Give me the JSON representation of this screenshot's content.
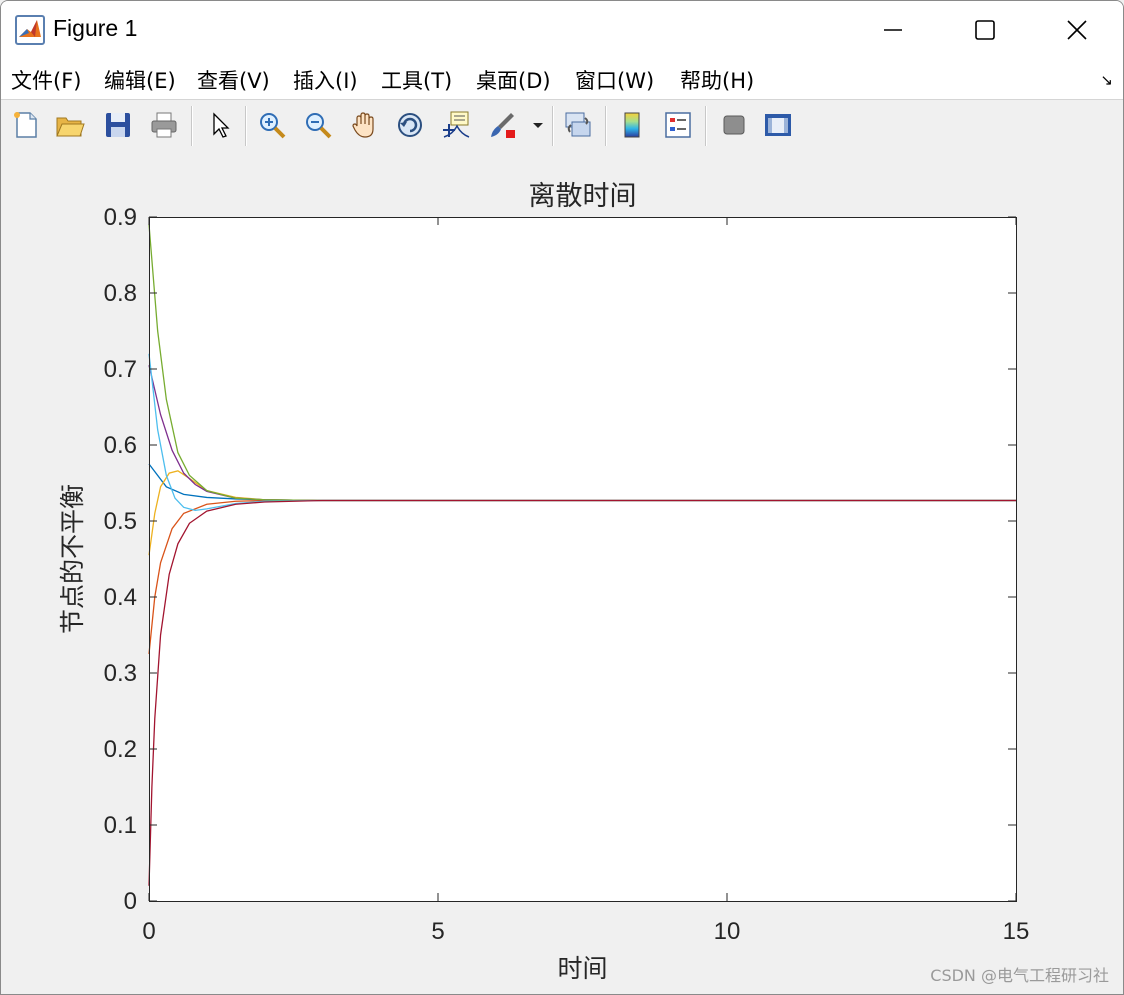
{
  "window": {
    "title": "Figure 1",
    "controls": {
      "minimize": "minimize-icon",
      "maximize": "maximize-icon",
      "close": "close-icon"
    }
  },
  "menubar": {
    "items": [
      "文件(F)",
      "编辑(E)",
      "查看(V)",
      "插入(I)",
      "工具(T)",
      "桌面(D)",
      "窗口(W)",
      "帮助(H)"
    ]
  },
  "toolbar": {
    "buttons": [
      "new-figure-icon",
      "open-file-icon",
      "save-icon",
      "print-icon",
      "pointer-arrow-icon",
      "zoom-in-icon",
      "zoom-out-icon",
      "pan-hand-icon",
      "rotate-3d-icon",
      "data-cursor-icon",
      "brush-icon",
      "brush-dropdown-icon",
      "link-plot-icon",
      "colorbar-icon",
      "legend-icon",
      "hide-plot-tools-icon",
      "show-plot-tools-icon"
    ]
  },
  "watermark": "CSDN @电气工程研习社",
  "chart_data": {
    "type": "line",
    "title": "离散时间",
    "xlabel": "时间",
    "ylabel": "节点的不平衡",
    "xlim": [
      0,
      15
    ],
    "ylim": [
      0,
      0.9
    ],
    "xticks": [
      "0",
      "5",
      "10",
      "15"
    ],
    "yticks": [
      "0",
      "0.1",
      "0.2",
      "0.3",
      "0.4",
      "0.5",
      "0.6",
      "0.7",
      "0.8",
      "0.9"
    ],
    "grid": false,
    "steady_value": 0.527,
    "series": [
      {
        "color": "#0072BD",
        "x": [
          0,
          0.3,
          0.6,
          1.0,
          1.5,
          2.0,
          3.0,
          15
        ],
        "y": [
          0.575,
          0.545,
          0.535,
          0.531,
          0.529,
          0.528,
          0.527,
          0.527
        ]
      },
      {
        "color": "#D95319",
        "x": [
          0,
          0.1,
          0.2,
          0.4,
          0.6,
          1.0,
          1.5,
          2.0,
          3.0,
          15
        ],
        "y": [
          0.325,
          0.4,
          0.445,
          0.49,
          0.51,
          0.522,
          0.526,
          0.527,
          0.527,
          0.527
        ]
      },
      {
        "color": "#EDB120",
        "x": [
          0,
          0.1,
          0.2,
          0.35,
          0.5,
          0.7,
          1.0,
          1.5,
          2.0,
          3.0,
          15
        ],
        "y": [
          0.455,
          0.51,
          0.545,
          0.563,
          0.566,
          0.556,
          0.54,
          0.531,
          0.528,
          0.527,
          0.527
        ]
      },
      {
        "color": "#7E2F8E",
        "x": [
          0,
          0.2,
          0.4,
          0.6,
          0.8,
          1.0,
          1.5,
          2.0,
          3.0,
          15
        ],
        "y": [
          0.705,
          0.64,
          0.593,
          0.563,
          0.548,
          0.539,
          0.53,
          0.528,
          0.527,
          0.527
        ]
      },
      {
        "color": "#77AC30",
        "x": [
          0,
          0.15,
          0.3,
          0.5,
          0.7,
          1.0,
          1.5,
          2.0,
          3.0,
          15
        ],
        "y": [
          0.89,
          0.75,
          0.66,
          0.59,
          0.56,
          0.54,
          0.53,
          0.528,
          0.527,
          0.527
        ]
      },
      {
        "color": "#4DBEEE",
        "x": [
          0,
          0.15,
          0.3,
          0.45,
          0.6,
          0.8,
          1.0,
          1.5,
          2.0,
          3.0,
          15
        ],
        "y": [
          0.72,
          0.62,
          0.56,
          0.53,
          0.518,
          0.514,
          0.516,
          0.523,
          0.526,
          0.527,
          0.527
        ]
      },
      {
        "color": "#A2142F",
        "x": [
          0,
          0.05,
          0.1,
          0.2,
          0.35,
          0.5,
          0.7,
          1.0,
          1.5,
          2.0,
          3.0,
          15
        ],
        "y": [
          0.02,
          0.15,
          0.24,
          0.35,
          0.43,
          0.47,
          0.497,
          0.513,
          0.522,
          0.525,
          0.527,
          0.527
        ]
      }
    ]
  }
}
